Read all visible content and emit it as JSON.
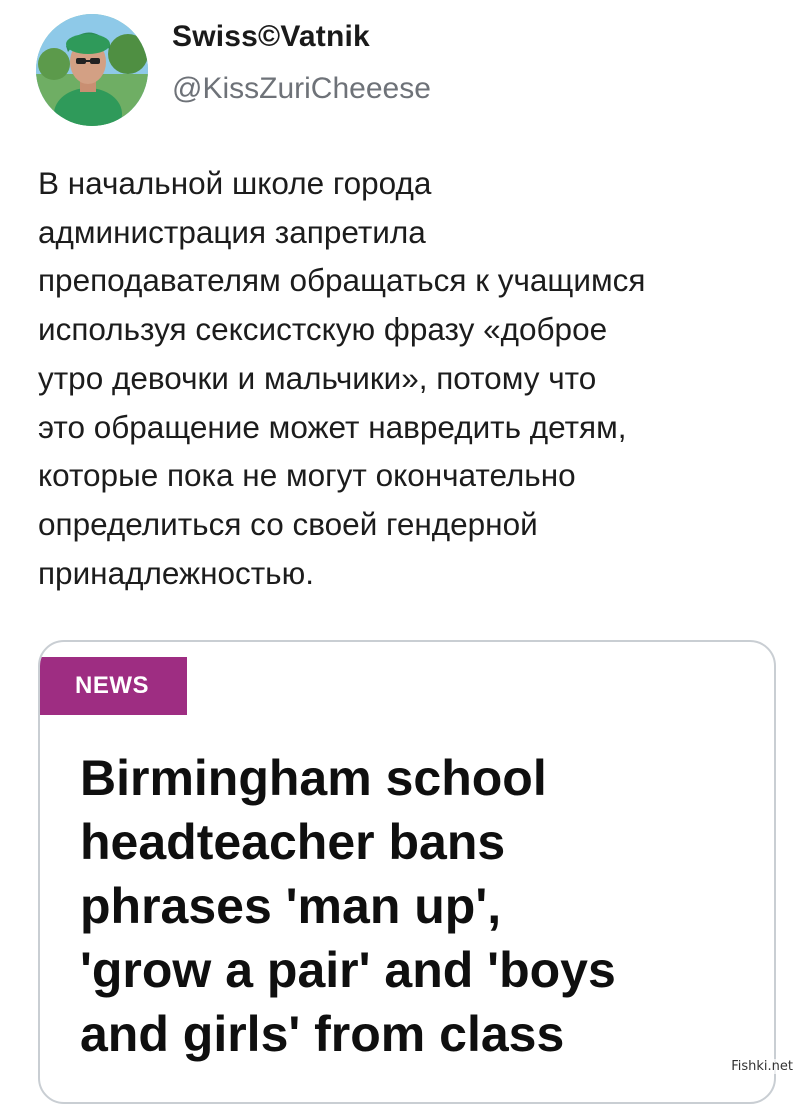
{
  "tweet": {
    "author": {
      "display_name": "Swiss©Vatnik",
      "handle": "@KissZuriCheeese"
    },
    "text_lines": [
      "В начальной школе города",
      "администрация запретила",
      "преподавателям обращаться к учащимся",
      "используя сексистскую фразу «доброе",
      "утро девочки и мальчики», потому что",
      "это обращение может навредить детям,",
      "которые пока не могут окончательно",
      "определиться со своей гендерной",
      "принадлежностью."
    ]
  },
  "card": {
    "badge": "NEWS",
    "badge_color": "#9e2d82",
    "headline_lines": [
      "Birmingham school",
      "headteacher bans",
      "phrases 'man up',",
      "'grow a pair' and 'boys",
      "and girls' from class"
    ]
  },
  "watermark": "Fishki.net"
}
